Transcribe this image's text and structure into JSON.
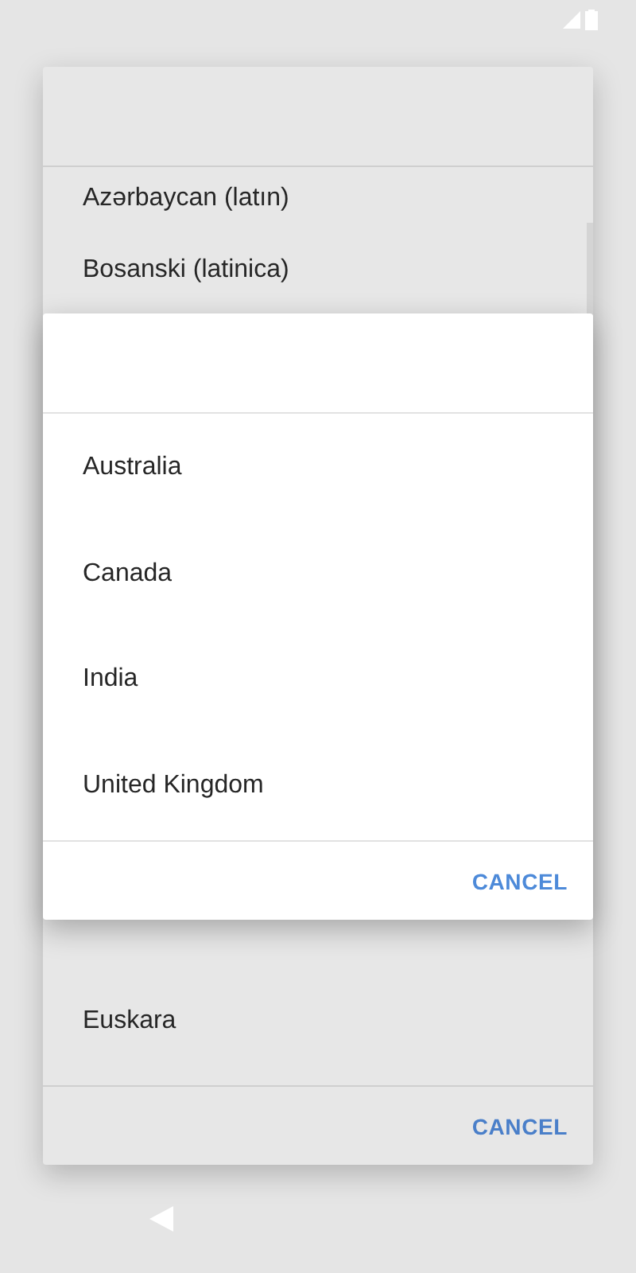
{
  "language_dialog": {
    "items": [
      {
        "label": "Azərbaycan (latın)"
      },
      {
        "label": "Bosanski (latinica)"
      },
      {
        "label": "Euskara"
      }
    ],
    "cancel": "CANCEL"
  },
  "country_dialog": {
    "items": [
      {
        "label": "Australia"
      },
      {
        "label": "Canada"
      },
      {
        "label": "India"
      },
      {
        "label": "United Kingdom"
      }
    ],
    "cancel": "CANCEL"
  }
}
